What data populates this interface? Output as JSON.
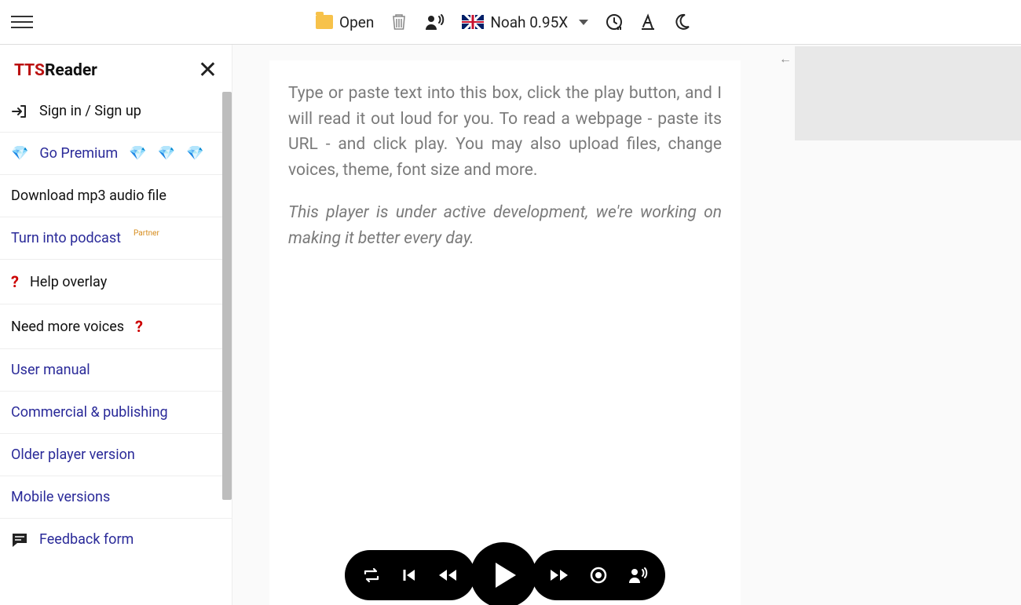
{
  "topbar": {
    "open_label": "Open",
    "voice_label": "Noah 0.95X"
  },
  "sidebar": {
    "logo_tts": "TTS",
    "logo_reader": "Reader",
    "items": {
      "signin": "Sign in / Sign up",
      "premium": "Go Premium",
      "download": "Download mp3 audio file",
      "podcast": "Turn into podcast",
      "podcast_badge": "Partner",
      "help": "Help overlay",
      "voices": "Need more voices",
      "manual": "User manual",
      "commercial": "Commercial & publishing",
      "older": "Older player version",
      "mobile": "Mobile versions",
      "feedback": "Feedback form"
    }
  },
  "editor": {
    "placeholder_p1": "Type or paste text into this box, click the play button, and I will read it out loud for you. To read a webpage - paste its URL - and click play. You may also upload files, change voices, theme, font size and more.",
    "placeholder_p2": "This player is under active development, we're working on making it better every day."
  }
}
